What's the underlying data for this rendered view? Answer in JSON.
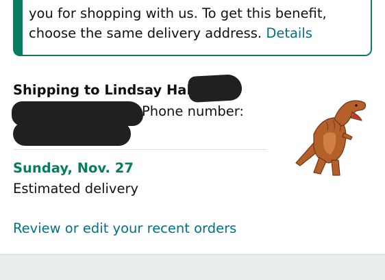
{
  "notice": {
    "line1": "you for shopping with us. To get this benefit,",
    "line2": "choose the same delivery address.",
    "details_link": "Details"
  },
  "shipping": {
    "title": "Shipping to Lindsay Hall,",
    "phone_label": "Phone number:"
  },
  "delivery": {
    "date": "Sunday, Nov. 27",
    "label": "Estimated delivery"
  },
  "orders_link": "Review or edit your recent orders",
  "colors": {
    "accent_green": "#067d62",
    "link_teal": "#007185",
    "text": "#0f1111",
    "redaction": "#202020"
  },
  "icons": {
    "sticker": "dinosaur-sticker"
  }
}
